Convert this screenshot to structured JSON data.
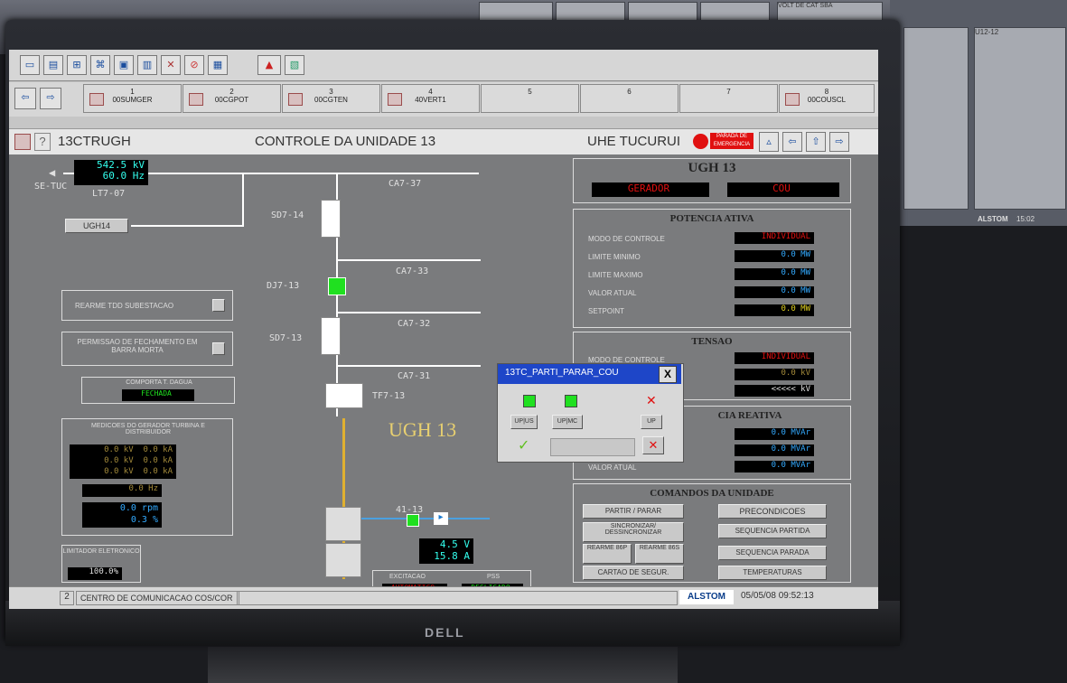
{
  "colors": {
    "accent": "#1a4d9e",
    "alarm": "#e01010",
    "ok_green": "#20e020",
    "screen_bg": "#7a7b7d",
    "toolbar": "#d6d6d6"
  },
  "background": {
    "rack_labels": [
      "VOLT DE CAT SBA",
      "U12-12",
      "ALSTOM",
      "15:02"
    ]
  },
  "toolbar": {
    "top_icons": [
      "window-icon",
      "print-icon",
      "network-icon",
      "tree-icon",
      "screen-icon",
      "chart-icon",
      "tools-icon",
      "stop-icon",
      "display-icon",
      "triangle-icon",
      "image-icon"
    ],
    "slots": [
      {
        "num": "1",
        "label": "00SUMGER"
      },
      {
        "num": "2",
        "label": "00CGPOT"
      },
      {
        "num": "3",
        "label": "00CGTEN"
      },
      {
        "num": "4",
        "label": "40VERT1"
      },
      {
        "num": "5",
        "label": ""
      },
      {
        "num": "6",
        "label": ""
      },
      {
        "num": "7",
        "label": ""
      },
      {
        "num": "8",
        "label": "00COUSCL"
      }
    ]
  },
  "header": {
    "code": "13CTRUGH",
    "title": "CONTROLE DA UNIDADE 13",
    "plant": "UHE TUCURUI",
    "emergency": "PARADA DE EMERGENCIA",
    "help": "?"
  },
  "diagram": {
    "line_kv": "542.5 kV",
    "line_hz": "60.0 Hz",
    "se": "SE-TUC",
    "lt": "LT7-07",
    "ugh14": "UGH14",
    "ca737": "CA7-37",
    "sd714": "SD7-14",
    "ca733": "CA7-33",
    "dj713": "DJ7-13",
    "ca732": "CA7-32",
    "sd713": "SD7-13",
    "ca731": "CA7-31",
    "tf713": "TF7-13",
    "ugh13": "UGH 13",
    "b4113": "41-13",
    "exc_v": "4.5 V",
    "exc_a": "15.8 A",
    "rearme": "REARME TDD SUBESTACAO",
    "permissao": "PERMISSAO DE FECHAMENTO EM BARRA MORTA",
    "comporta": "COMPORTA T. DAGUA",
    "comporta_val": "FECHADA",
    "medicoes": "MEDICOES DO GERADOR TURBINA E DISTRIBUIDOR",
    "med_rows": [
      [
        "0.0 kV",
        "0.0 kA"
      ],
      [
        "0.0 kV",
        "0.0 kA"
      ],
      [
        "0.0 kV",
        "0.0 kA"
      ]
    ],
    "hz": "0.0 Hz",
    "rpm": "0.0 rpm",
    "pct": "0.3 %",
    "limitador": "LIMITADOR ELETRONICO",
    "limitador_val": "100.0%",
    "excitacao": "EXCITACAO",
    "exc_mode": "AUTOMATICO",
    "pss": "PSS",
    "pss_val": "DESLIGADO"
  },
  "right": {
    "ugh_title": "UGH 13",
    "gerador": "GERADOR",
    "cou": "COU",
    "pot_title": "POTENCIA ATIVA",
    "pot_rows": [
      {
        "label": "MODO DE CONTROLE",
        "value": "INDIVIDUAL"
      },
      {
        "label": "LIMITE MINIMO",
        "value": "0.0  MW"
      },
      {
        "label": "LIMITE MAXIMO",
        "value": "0.0  MW"
      },
      {
        "label": "VALOR ATUAL",
        "value": "0.0  MW"
      },
      {
        "label": "SETPOINT",
        "value": "0.0  MW"
      }
    ],
    "ten_title": "TENSAO",
    "ten_rows": [
      {
        "label": "MODO DE CONTROLE",
        "value": "INDIVIDUAL"
      },
      {
        "label": "",
        "value": "0.0  kV"
      },
      {
        "label": "",
        "value": "<<<<<  kV"
      }
    ],
    "reat_title": "CIA REATIVA",
    "reat_rows": [
      {
        "label": "",
        "value": "0.0 MVAr"
      },
      {
        "label": "",
        "value": "0.0 MVAr"
      },
      {
        "label": "VALOR ATUAL",
        "value": "0.0 MVAr"
      }
    ],
    "cmd_title": "COMANDOS DA UNIDADE",
    "cmd_buttons": {
      "partir": "PARTIR / PARAR",
      "precond": "PRECONDICOES",
      "sinc": "SINCRONIZAR/ DESSINCRONIZAR",
      "seq_partida": "SEQUENCIA PARTIDA",
      "rearme86p": "REARME 86P",
      "rearme86s": "REARME 86S",
      "seq_parada": "SEQUENCIA PARADA",
      "cartao": "CARTAO DE SEGUR.",
      "temperaturas": "TEMPERATURAS"
    }
  },
  "popup": {
    "title": "13TC_PARTI_PARAR_COU",
    "close": "X",
    "b1": "UP|US",
    "b2": "UP|MC",
    "b3": "UP"
  },
  "status": {
    "num": "2",
    "text": "CENTRO DE COMUNICACAO COS/COR",
    "brand": "ALSTOM",
    "datetime": "05/05/08 09:52:13"
  },
  "monitor": {
    "brand": "DELL"
  }
}
